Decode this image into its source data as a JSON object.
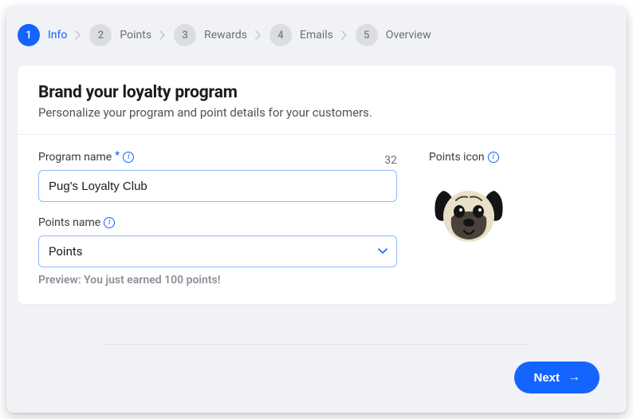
{
  "stepper": {
    "steps": [
      {
        "num": "1",
        "label": "Info",
        "active": true
      },
      {
        "num": "2",
        "label": "Points",
        "active": false
      },
      {
        "num": "3",
        "label": "Rewards",
        "active": false
      },
      {
        "num": "4",
        "label": "Emails",
        "active": false
      },
      {
        "num": "5",
        "label": "Overview",
        "active": false
      }
    ]
  },
  "card": {
    "title": "Brand your loyalty program",
    "subtitle": "Personalize your program and point details for your customers."
  },
  "form": {
    "program_name_label": "Program name",
    "program_name_value": "Pug's Loyalty Club",
    "program_name_count": "32",
    "points_name_label": "Points name",
    "points_name_value": "Points",
    "preview_text": "Preview: You just earned 100 points!",
    "points_icon_label": "Points icon"
  },
  "footer": {
    "next_label": "Next"
  },
  "icons": {
    "info": "i",
    "required": "*",
    "arrow_right": "→"
  },
  "colors": {
    "accent": "#1464ff"
  }
}
